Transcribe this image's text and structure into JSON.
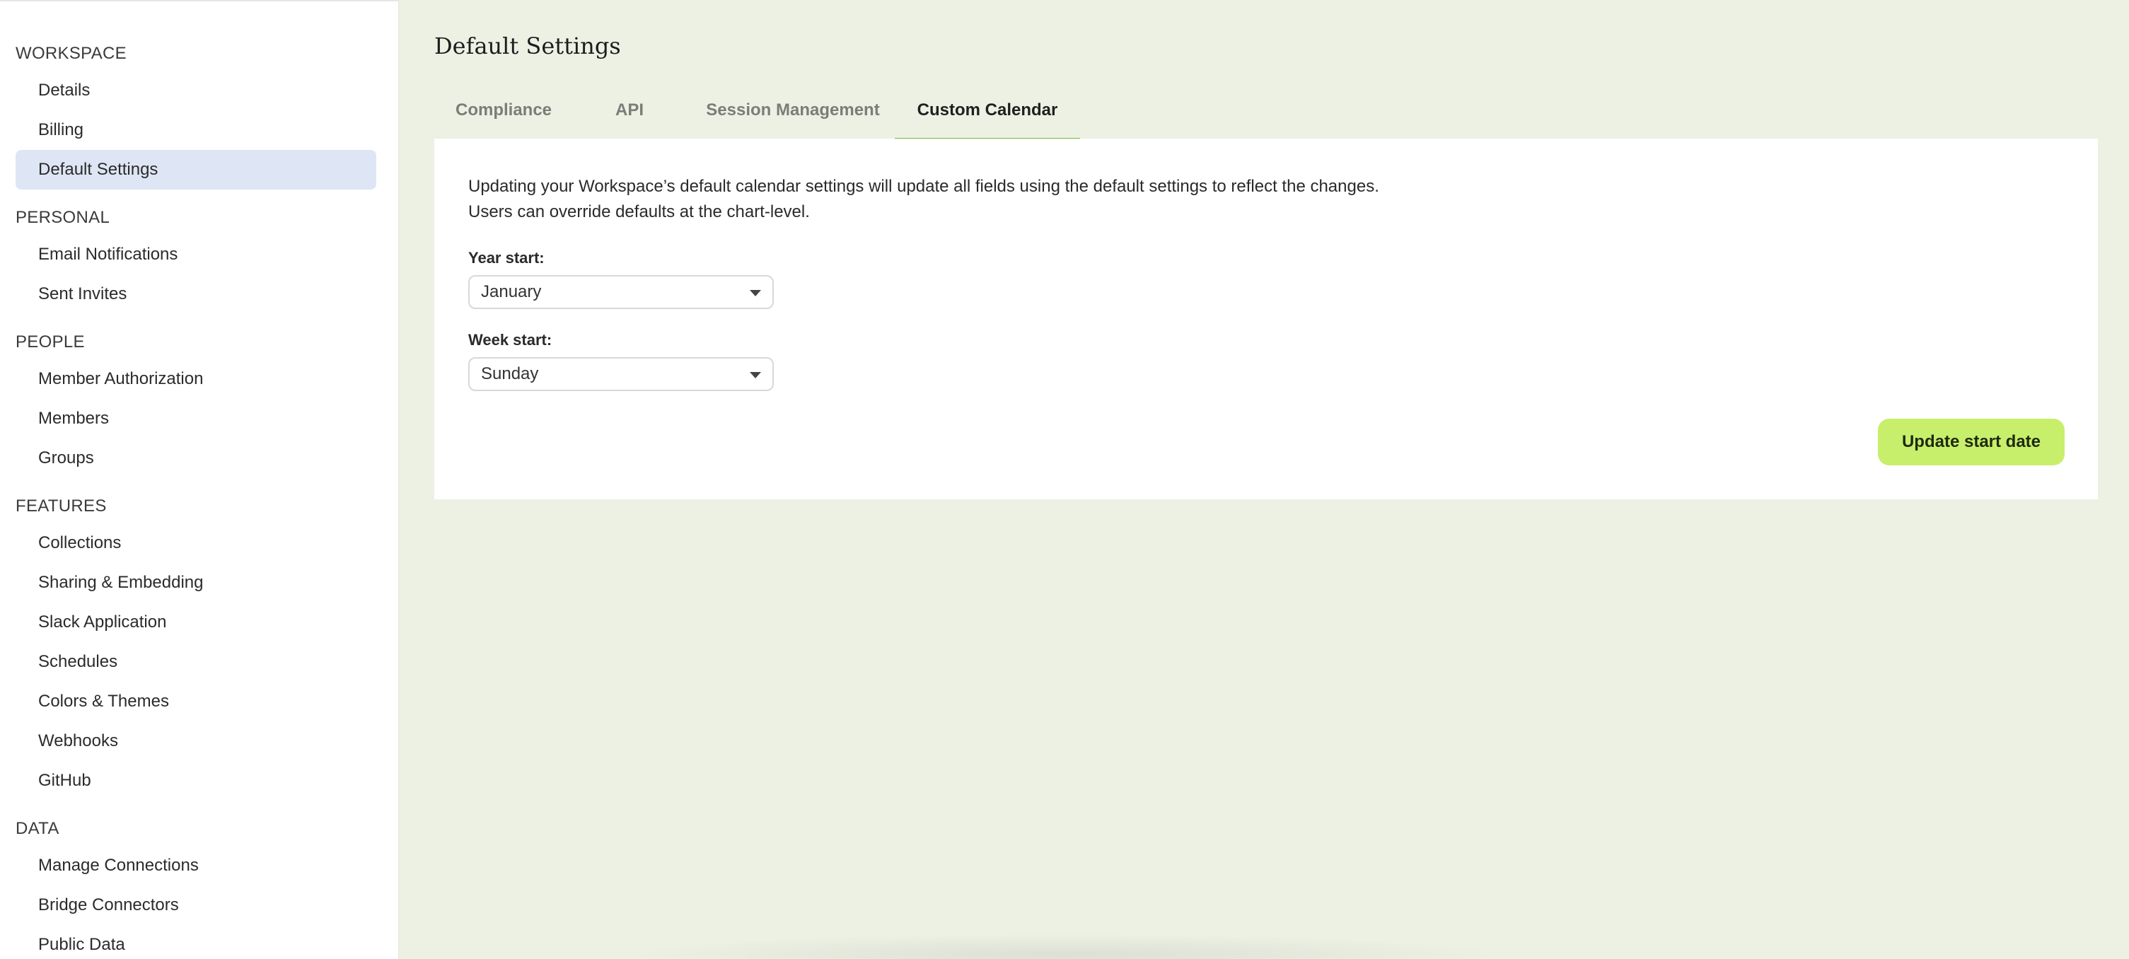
{
  "sidebar": {
    "sections": [
      {
        "title": "WORKSPACE",
        "items": [
          {
            "label": "Details"
          },
          {
            "label": "Billing"
          },
          {
            "label": "Default Settings",
            "active": true
          }
        ]
      },
      {
        "title": "PERSONAL",
        "items": [
          {
            "label": "Email Notifications"
          },
          {
            "label": "Sent Invites"
          }
        ]
      },
      {
        "title": "PEOPLE",
        "items": [
          {
            "label": "Member Authorization"
          },
          {
            "label": "Members"
          },
          {
            "label": "Groups"
          }
        ]
      },
      {
        "title": "FEATURES",
        "items": [
          {
            "label": "Collections"
          },
          {
            "label": "Sharing & Embedding"
          },
          {
            "label": "Slack Application"
          },
          {
            "label": "Schedules"
          },
          {
            "label": "Colors & Themes"
          },
          {
            "label": "Webhooks"
          },
          {
            "label": "GitHub"
          }
        ]
      },
      {
        "title": "DATA",
        "items": [
          {
            "label": "Manage Connections"
          },
          {
            "label": "Bridge Connectors"
          },
          {
            "label": "Public Data"
          }
        ]
      }
    ]
  },
  "main": {
    "title": "Default Settings",
    "tabs": [
      {
        "label": "Compliance"
      },
      {
        "label": "API"
      },
      {
        "label": "Session Management"
      },
      {
        "label": "Custom Calendar",
        "active": true
      }
    ],
    "panel": {
      "description_line1": "Updating your Workspace’s default calendar settings will update all fields using the default settings to reflect the changes.",
      "description_line2": "Users can override defaults at the chart-level.",
      "year_start_label": "Year start:",
      "year_start_value": "January",
      "week_start_label": "Week start:",
      "week_start_value": "Sunday",
      "update_button": "Update start date"
    }
  },
  "colors": {
    "accent_green": "#75b82c",
    "button_green": "#c8ef6b",
    "active_nav": "#dee6f5",
    "page_background": "#edf1e4"
  }
}
